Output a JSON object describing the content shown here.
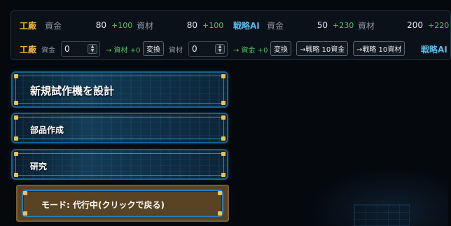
{
  "resources": {
    "factory": {
      "team": "工廠",
      "funds_label": "資金",
      "funds_value": "80",
      "funds_delta": "+100",
      "materials_label": "資材",
      "materials_value": "80",
      "materials_delta": "+100"
    },
    "ai": {
      "team": "戦略AI",
      "funds_label": "資金",
      "funds_value": "50",
      "funds_delta": "+230",
      "materials_label": "資材",
      "materials_value": "200",
      "materials_delta": "+220"
    }
  },
  "exchange": {
    "team": "工廠",
    "funds_label": "資金",
    "funds_input": "0",
    "funds_result": "→ 資材 +0",
    "funds_convert": "変換",
    "materials_label": "資材",
    "materials_input": "0",
    "materials_result": "→ 資金 +0",
    "materials_convert": "変換",
    "to_ai_funds": "→戦略 10資金",
    "to_ai_materials": "→戦略 10資材",
    "ai_team": "戦略AI"
  },
  "menu": {
    "design": "新規試作機を設計",
    "parts": "部品作成",
    "research": "研究",
    "mode": "モード: 代行中(クリックで戻る)"
  },
  "colors": {
    "factory": "#f0b43c",
    "ai": "#5ab8e8",
    "delta": "#4fc26b",
    "corner": "#f0c050",
    "mode_bg": "#5a4322"
  }
}
